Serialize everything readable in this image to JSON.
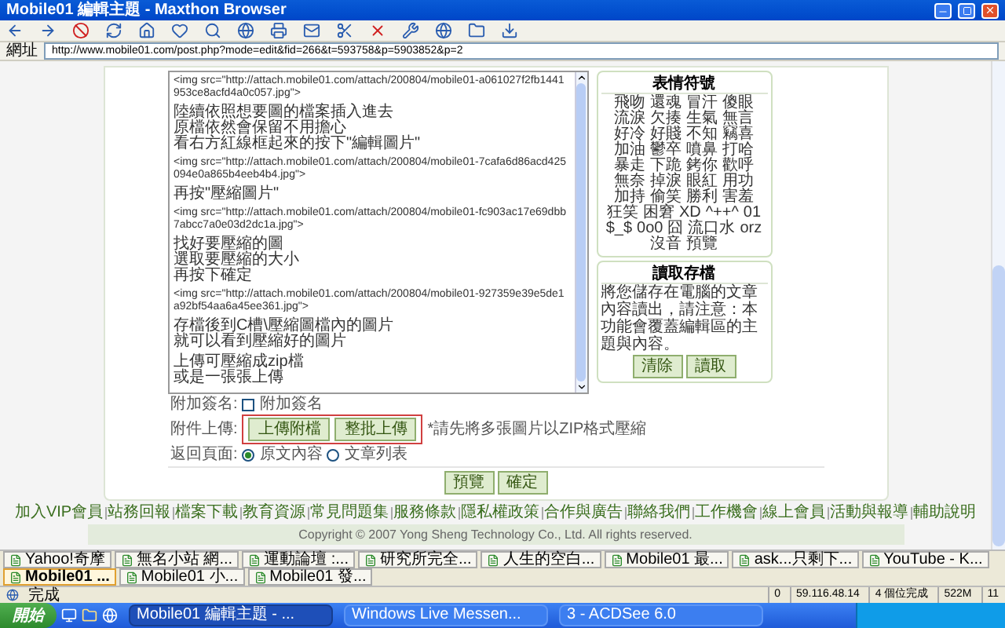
{
  "window": {
    "title": "Mobile01 編輯主題 - Maxthon Browser"
  },
  "address_bar": {
    "label": "網址",
    "url": "http://www.mobile01.com/post.php?mode=edit&fid=266&t=593758&p=5903852&p=2"
  },
  "editor": {
    "paragraphs": [
      {
        "kind": "code",
        "lines": [
          "<img src=\"http://attach.mobile01.com/attach/200804/mobile01-a061027f2fb1441953ce8acfd4a0c057.jpg\">"
        ]
      },
      {
        "kind": "text",
        "lines": [
          "陸續依照想要圖的檔案插入進去",
          "原檔依然會保留不用擔心",
          "看右方紅線框起來的按下\"編輯圖片\""
        ]
      },
      {
        "kind": "code",
        "lines": [
          "<img src=\"http://attach.mobile01.com/attach/200804/mobile01-7cafa6d86acd425094e0a865b4eeb4b4.jpg\">"
        ]
      },
      {
        "kind": "text",
        "lines": [
          "再按\"壓縮圖片\""
        ]
      },
      {
        "kind": "code",
        "lines": [
          "<img src=\"http://attach.mobile01.com/attach/200804/mobile01-fc903ac17e69dbb7abcc7a0e03d2dc1a.jpg\">"
        ]
      },
      {
        "kind": "text",
        "lines": [
          "找好要壓縮的圖",
          "選取要壓縮的大小",
          "再按下確定"
        ]
      },
      {
        "kind": "code",
        "lines": [
          "<img src=\"http://attach.mobile01.com/attach/200804/mobile01-927359e39e5de1a92bf54aa6a45ee361.jpg\">"
        ]
      },
      {
        "kind": "text",
        "lines": [
          "存檔後到C槽\\壓縮圖檔內的圖片",
          "就可以看到壓縮好的圖片"
        ]
      },
      {
        "kind": "text",
        "lines": [
          "上傳可壓縮成zip檔",
          "或是一張張上傳"
        ]
      }
    ]
  },
  "emoticons": {
    "title": "表情符號",
    "items": [
      "飛吻",
      "還魂",
      "冒汗",
      "傻眼",
      "流淚",
      "欠揍",
      "生氣",
      "無言",
      "好冷",
      "好賤",
      "不知",
      "竊喜",
      "加油",
      "鬱卒",
      "噴鼻",
      "打哈",
      "暴走",
      "下跪",
      "銬你",
      "歡呼",
      "無奈",
      "掉淚",
      "眼紅",
      "用功",
      "加持",
      "偷笑",
      "勝利",
      "害羞",
      "狂笑",
      "困窘",
      "XD",
      "^++^",
      "01",
      "$_$",
      "0o0",
      "囧",
      "流口水",
      "orz",
      "沒音",
      "預覽"
    ]
  },
  "draft": {
    "title": "讀取存檔",
    "text": "將您儲存在電腦的文章內容讀出，請注意：本功能會覆蓋編輯區的主題與內容。",
    "buttons": [
      "清除",
      "讀取"
    ]
  },
  "form": {
    "signature": {
      "label": "附加簽名:",
      "option": "附加簽名",
      "checked": false
    },
    "attachment": {
      "label": "附件上傳:",
      "buttons": [
        "上傳附檔",
        "整批上傳"
      ],
      "note": "*請先將多張圖片以ZIP格式壓縮"
    },
    "return_page": {
      "label": "返回頁面:",
      "options": [
        {
          "label": "原文內容",
          "selected": true
        },
        {
          "label": "文章列表",
          "selected": false
        }
      ]
    }
  },
  "actions": [
    "預覽",
    "確定"
  ],
  "footer_links": [
    "加入VIP會員",
    "站務回報",
    "檔案下載",
    "教育資源",
    "常見問題集",
    "服務條款",
    "隱私權政策",
    "合作與廣告",
    "聯絡我們",
    "工作機會",
    "線上會員",
    "活動與報導",
    "輔助說明"
  ],
  "copyright": "Copyright © 2007 Yong Sheng Technology Co., Ltd. All rights reserved.",
  "browser_tabs": [
    {
      "label": "Yahoo!奇摩",
      "selected": false
    },
    {
      "label": "無名小站 網...",
      "selected": false
    },
    {
      "label": "運動論壇 :...",
      "selected": false
    },
    {
      "label": "研究所完全...",
      "selected": false
    },
    {
      "label": "人生的空白...",
      "selected": false
    },
    {
      "label": "Mobile01 最...",
      "selected": false
    },
    {
      "label": "ask...只剩下...",
      "selected": false
    },
    {
      "label": "YouTube - K...",
      "selected": false
    },
    {
      "label": "Mobile01 ...",
      "selected": true
    },
    {
      "label": "Mobile01 小...",
      "selected": false
    },
    {
      "label": "Mobile01 發...",
      "selected": false
    }
  ],
  "status_bar": {
    "text": "完成",
    "items": [
      "0",
      "59.116.48.14",
      "4 個位完成",
      "522M",
      "11"
    ]
  },
  "taskbar": {
    "start": "開始",
    "tasks": [
      {
        "label": "Mobile01 編輯主題 - ...",
        "selected": true
      },
      {
        "label": "Windows Live Messen...",
        "selected": false
      },
      {
        "label": "3 - ACDSee 6.0",
        "selected": false
      }
    ]
  }
}
